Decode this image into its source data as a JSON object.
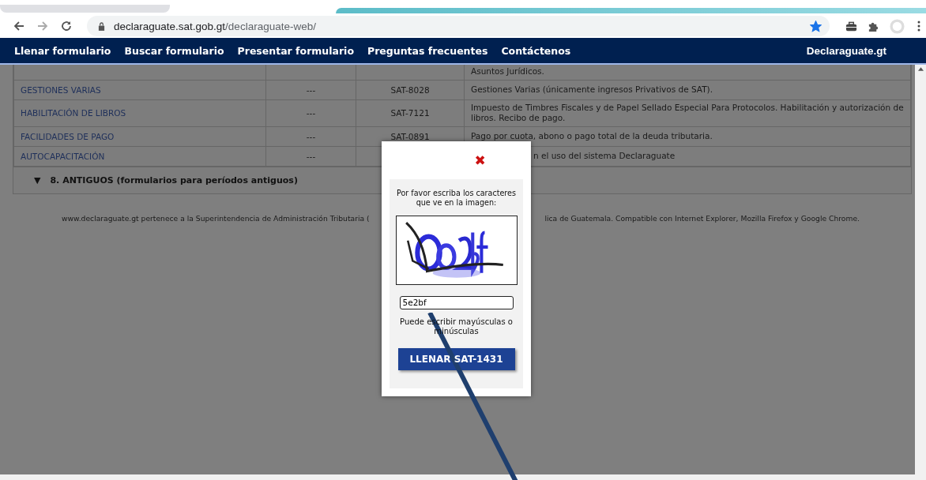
{
  "browser": {
    "url_host": "declaraguate.sat.gob.gt",
    "url_path": "/declaraguate-web/",
    "bookmarked": true
  },
  "nav": {
    "items": [
      {
        "label": "Llenar formulario"
      },
      {
        "label": "Buscar formulario"
      },
      {
        "label": "Presentar formulario"
      },
      {
        "label": "Preguntas frecuentes"
      },
      {
        "label": "Contáctenos"
      }
    ],
    "brand": "Declaraguate.gt"
  },
  "table": {
    "rows": [
      {
        "description": "Asuntos Jurídicos."
      },
      {
        "name": "GESTIONES VARIAS",
        "period": "---",
        "code": "SAT-8028",
        "description": "Gestiones Varias (únicamente ingresos Privativos de SAT)."
      },
      {
        "name": "HABILITACIÓN DE LIBROS",
        "period": "---",
        "code": "SAT-7121",
        "description": "Impuesto de Timbres Fiscales y de Papel Sellado Especial Para Protocolos. Habilitación y autorización de libros. Recibo de pago."
      },
      {
        "name": "FACILIDADES DE PAGO",
        "period": "---",
        "code": "SAT-0891",
        "description": "Pago por cuota, abono o pago total de la deuda tributaria."
      },
      {
        "name": "AUTOCAPACITACIÓN",
        "period": "---",
        "description": "n el uso del sistema Declaraguate"
      }
    ]
  },
  "section": {
    "label": "8. ANTIGUOS (formularios para períodos antiguos)",
    "expanded": true,
    "toggle": "▼"
  },
  "footer": {
    "left": "www.declaraguate.gt pertenece a la Superintendencia de Administración Tributaria (",
    "right": "lica de Guatemala. Compatible con Internet Explorer, Mozilla Firefox y Google Chrome."
  },
  "dialog": {
    "close": "✖",
    "prompt": "Por favor escriba los caracteres que ve en la imagen:",
    "value": "5e2bf",
    "hint": "Puede escribir mayúsculas o minúsculas",
    "button": "LLENAR SAT-1431"
  }
}
